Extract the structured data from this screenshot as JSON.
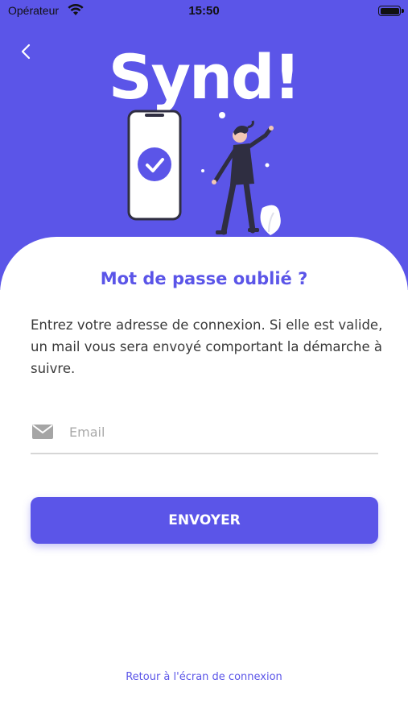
{
  "status_bar": {
    "carrier": "Opérateur",
    "time": "15:50"
  },
  "brand": {
    "logo_text": "Synd!"
  },
  "colors": {
    "accent": "#5b55e8",
    "hero_background": "#5b55e8"
  },
  "icons": {
    "back": "chevron-left-icon",
    "email": "mail-icon",
    "wifi": "wifi-icon",
    "battery": "battery-icon"
  },
  "form": {
    "title": "Mot de passe oublié ?",
    "description": "Entrez votre adresse de connexion. Si elle est valide, un mail vous sera envoyé comportant la démarche à suivre.",
    "email_placeholder": "Email",
    "email_value": "",
    "submit_label": "ENVOYER"
  },
  "footer": {
    "back_to_login_label": "Retour à l'écran de connexion"
  }
}
